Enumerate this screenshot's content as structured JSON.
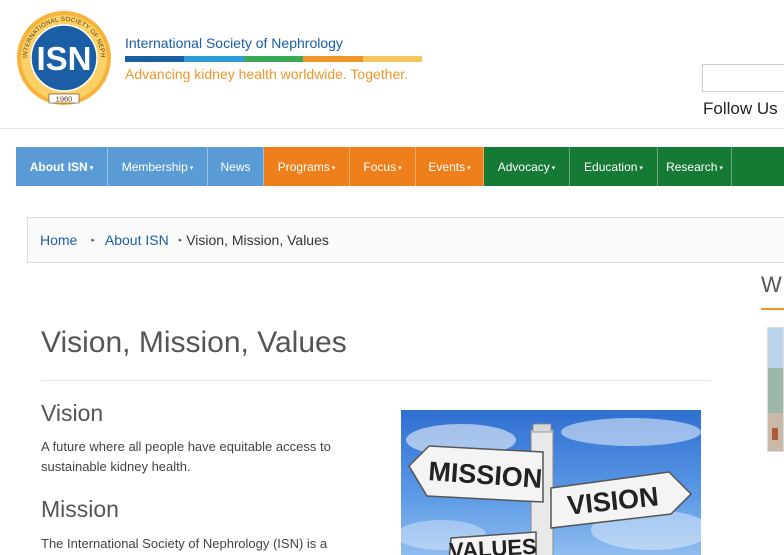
{
  "header": {
    "logo": {
      "acronym": "ISN",
      "ring_text": "INTERNATIONAL SOCIETY OF NEPHROLOGY",
      "year": "1960"
    },
    "org_name": "International Society of Nephrology",
    "tagline": "Advancing kidney health worldwide. Together.",
    "stripe_colors": [
      "#1a5fa6",
      "#2d9bd6",
      "#3aa856",
      "#f0962c",
      "#f7c65a"
    ],
    "follow_label": "Follow Us"
  },
  "nav": {
    "items": [
      {
        "label": "About ISN",
        "caret": true,
        "color": "#5b9bd5"
      },
      {
        "label": "Membership",
        "caret": true,
        "color": "#5b9bd5"
      },
      {
        "label": "News",
        "caret": false,
        "color": "#5b9bd5"
      },
      {
        "label": "Programs",
        "caret": true,
        "color": "#ef7f1a"
      },
      {
        "label": "Focus",
        "caret": true,
        "color": "#ef7f1a"
      },
      {
        "label": "Events",
        "caret": true,
        "color": "#ef7f1a"
      },
      {
        "label": "Advocacy",
        "caret": true,
        "color": "#147a34"
      },
      {
        "label": "Education",
        "caret": true,
        "color": "#147a34"
      },
      {
        "label": "Research",
        "caret": true,
        "color": "#147a34"
      }
    ]
  },
  "breadcrumb": {
    "home": "Home",
    "parent": "About ISN",
    "current": "Vision, Mission, Values",
    "separator": "▸"
  },
  "main": {
    "title": "Vision, Mission, Values",
    "vision_heading": "Vision",
    "vision_text": "A future where all people have equitable access to sustainable kidney health.",
    "mission_heading": "Mission",
    "mission_text": "The International Society of Nephrology (ISN) is a",
    "sign_words": [
      "MISSION",
      "VISION",
      "VALUES"
    ]
  },
  "sidebar": {
    "heading_fragment": "W"
  }
}
